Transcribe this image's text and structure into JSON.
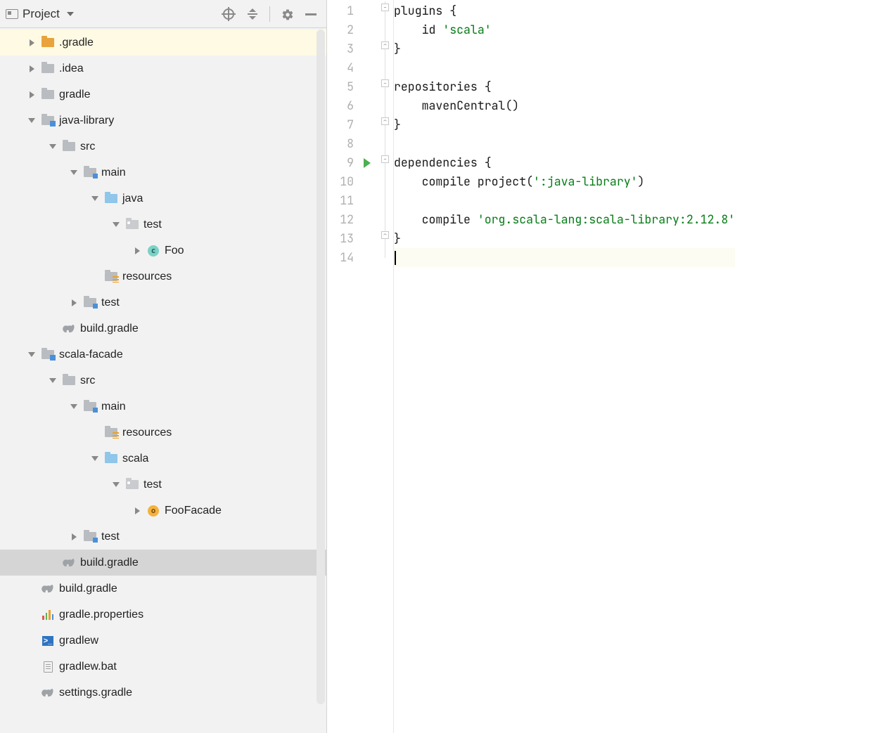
{
  "sidebar": {
    "title": "Project"
  },
  "tree": {
    "gradle_dir": ".gradle",
    "idea_dir": ".idea",
    "gradle_folder": "gradle",
    "java_library": "java-library",
    "src": "src",
    "main": "main",
    "java_pkg": "java",
    "test_pkg": "test",
    "foo_class": "Foo",
    "resources": "resources",
    "test_folder": "test",
    "build_gradle": "build.gradle",
    "scala_facade": "scala-facade",
    "scala_pkg": "scala",
    "foofacade_class": "FooFacade",
    "root_build_gradle": "build.gradle",
    "gradle_properties": "gradle.properties",
    "gradlew": "gradlew",
    "gradlew_bat": "gradlew.bat",
    "settings_gradle": "settings.gradle"
  },
  "editor": {
    "lines": {
      "l1": "plugins {",
      "l2": "    id 'scala'",
      "l3": "}",
      "l4": "",
      "l5": "repositories {",
      "l6": "    mavenCentral()",
      "l7": "}",
      "l8": "",
      "l9": "dependencies {",
      "l10": "    compile project(':java-library')",
      "l11": "",
      "l12": "    compile 'org.scala-lang:scala-library:2.12.8'",
      "l13": "}",
      "l14": ""
    }
  },
  "line_numbers": [
    "1",
    "2",
    "3",
    "4",
    "5",
    "6",
    "7",
    "8",
    "9",
    "10",
    "11",
    "12",
    "13",
    "14"
  ]
}
